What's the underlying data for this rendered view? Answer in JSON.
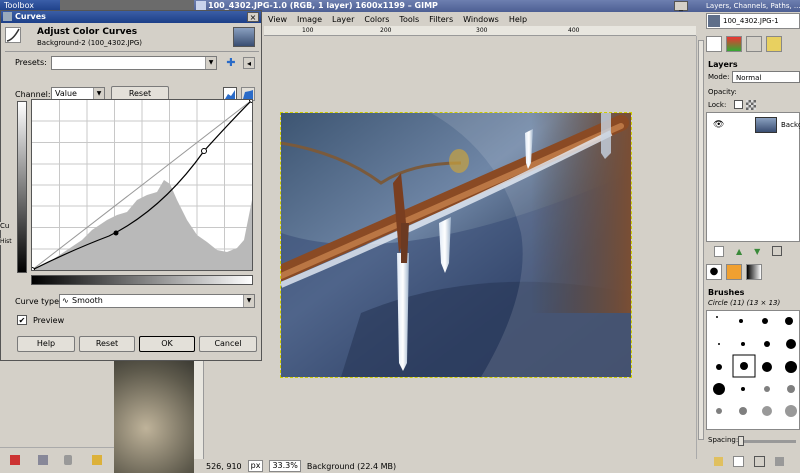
{
  "toolbox": {
    "title": "Toolbox"
  },
  "image_window": {
    "title": "100_4302.JPG-1.0 (RGB, 1 layer) 1600x1199 – GIMP",
    "menu": [
      "View",
      "Image",
      "Layer",
      "Colors",
      "Tools",
      "Filters",
      "Windows",
      "Help"
    ],
    "ruler_labels": [
      "100",
      "200",
      "300",
      "400"
    ],
    "status": {
      "coords": "526, 910",
      "unit": "px",
      "zoom": "33.3%",
      "info": "Background (22.4 MB)"
    }
  },
  "curves_dialog": {
    "window_title": "Curves",
    "heading": "Adjust Color Curves",
    "subheading": "Background-2 (100_4302.JPG)",
    "presets_label": "Presets:",
    "presets_value": "",
    "channel_label": "Channel:",
    "channel_value": "Value",
    "reset_channel": "Reset Channel",
    "curve_type_label": "Curve type:",
    "curve_type_value": "Smooth",
    "preview_label": "Preview",
    "preview_checked": true,
    "buttons": {
      "help": "Help",
      "reset": "Reset",
      "ok": "OK",
      "cancel": "Cancel"
    },
    "curve_points": [
      [
        0,
        0
      ],
      [
        0.35,
        0.2
      ],
      [
        0.73,
        0.7
      ],
      [
        1,
        1
      ]
    ]
  },
  "dock": {
    "title": "Layers, Channels, Paths, ...",
    "image_name": "100_4302.JPG-1",
    "layers_heading": "Layers",
    "mode_label": "Mode:",
    "mode_value": "Normal",
    "opacity_label": "Opacity:",
    "lock_label": "Lock:",
    "layer_name": "Backg",
    "brushes_heading": "Brushes",
    "brush_info": "Circle (11) (13 × 13)",
    "spacing_label": "Spacing:"
  },
  "left_fragments": {
    "cu": "Cu",
    "his": "Hist"
  },
  "colors": {
    "title_blue": "#2a4c98",
    "bg": "#d4d0c8"
  }
}
